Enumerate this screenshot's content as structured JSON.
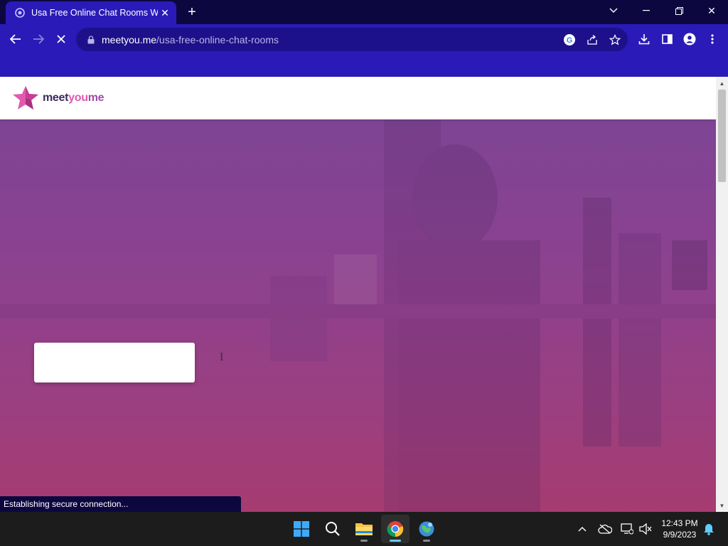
{
  "browser": {
    "tab_title": "Usa Free Online Chat Rooms With",
    "url_domain": "meetyou.me",
    "url_path": "/usa-free-online-chat-rooms",
    "status_text": "Establishing secure connection..."
  },
  "site": {
    "logo_meet": "meet",
    "logo_you": "you",
    "logo_me": "me"
  },
  "taskbar": {
    "time": "12:43 PM",
    "date": "9/9/2023"
  },
  "colors": {
    "chrome_dark": "#0d0740",
    "chrome_accent": "#2a1bb8",
    "hero_top": "#7e4494",
    "hero_bottom": "#a63c70",
    "logo_pink": "#e05ab0"
  },
  "icons": [
    "tab-favicon-icon",
    "close-icon",
    "plus-icon",
    "chevron-down-icon",
    "minimize-icon",
    "restore-icon",
    "window-close-icon",
    "back-arrow-icon",
    "forward-arrow-icon",
    "stop-loading-icon",
    "lock-icon",
    "google-icon",
    "share-icon",
    "star-icon",
    "download-icon",
    "side-panel-icon",
    "profile-icon",
    "menu-dots-icon",
    "windows-start-icon",
    "search-icon",
    "file-explorer-icon",
    "chrome-icon",
    "browser-globe-icon",
    "chevron-up-icon",
    "cloud-offline-icon",
    "network-icon",
    "volume-muted-icon",
    "bell-icon"
  ]
}
